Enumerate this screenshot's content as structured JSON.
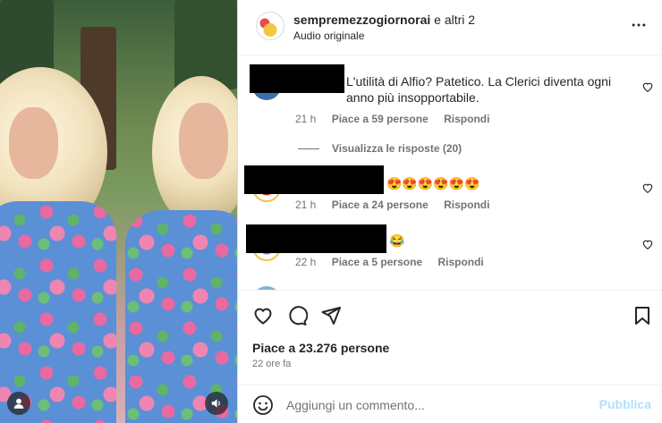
{
  "post": {
    "author": "sempremezzogiornorai",
    "coauthors": "e altri 2",
    "subtitle": "Audio originale"
  },
  "icons": {
    "more": "more-horizontal-icon",
    "heart": "heart-outline-icon",
    "comment": "comment-bubble-icon",
    "share": "paper-plane-icon",
    "save": "bookmark-icon",
    "emoji": "emoji-smile-icon",
    "user": "user-icon",
    "sound": "speaker-icon"
  },
  "comments": [
    {
      "text": "L'utilità di Alfio? Patetico. La Clerici diventa ogni anno più insopportabile.",
      "time": "21 h",
      "likes": "Piace a 59 persone",
      "reply": "Rispondi",
      "view_replies": "Visualizza le risposte (20)"
    },
    {
      "text": "😍😍😍😍😍😍",
      "time": "21 h",
      "likes": "Piace a 24 persone",
      "reply": "Rispondi"
    },
    {
      "text": "😂",
      "time": "22 h",
      "likes": "Piace a 5 persone",
      "reply": "Rispondi"
    }
  ],
  "actions": {
    "likes": "Piace a 23.276 persone",
    "time_ago": "22 ore fa"
  },
  "composer": {
    "placeholder": "Aggiungi un commento...",
    "publish": "Pubblica"
  },
  "colors": {
    "accent_disabled": "#b2dffc",
    "secondary_text": "#737373",
    "primary_text": "#262626"
  }
}
